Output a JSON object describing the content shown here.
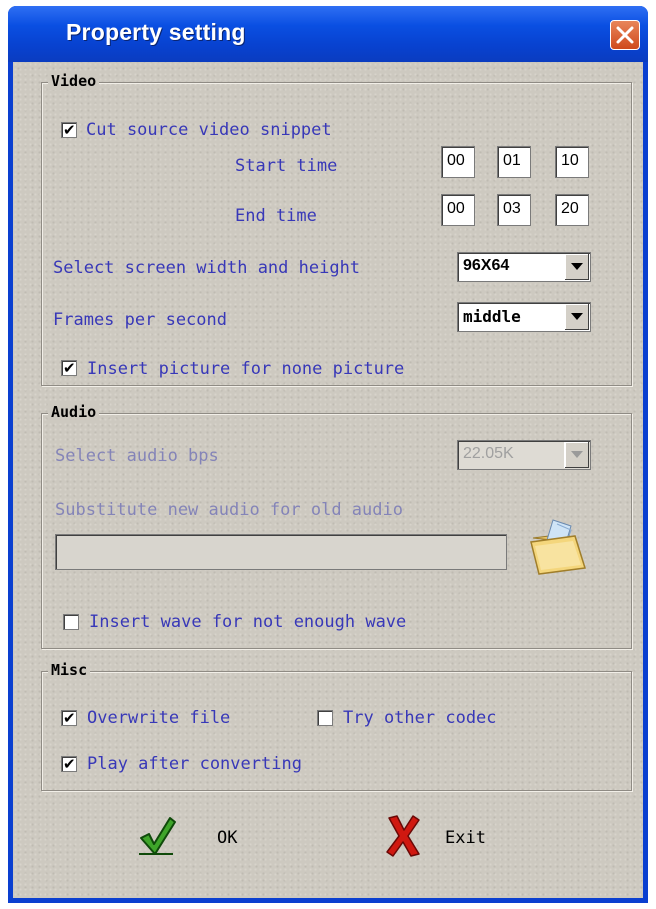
{
  "window": {
    "title": "Property setting"
  },
  "video": {
    "group_label": "Video",
    "cut_snippet": {
      "label": "Cut source video snippet",
      "checked": true
    },
    "start_time": {
      "label": "Start time",
      "hh": "00",
      "mm": "01",
      "ss": "10"
    },
    "end_time": {
      "label": "End time",
      "hh": "00",
      "mm": "03",
      "ss": "20"
    },
    "screen_size": {
      "label": "Select screen width and height",
      "value": "96X64"
    },
    "fps": {
      "label": "Frames per second",
      "value": "middle"
    },
    "insert_picture": {
      "label": "Insert picture for none picture",
      "checked": true
    }
  },
  "audio": {
    "group_label": "Audio",
    "bps": {
      "label": "Select audio bps",
      "value": "22.05K",
      "enabled": false
    },
    "substitute": {
      "label": "Substitute new audio for old audio",
      "path": ""
    },
    "insert_wave": {
      "label": "Insert wave for not enough wave",
      "checked": false
    }
  },
  "misc": {
    "group_label": "Misc",
    "overwrite": {
      "label": "Overwrite file",
      "checked": true
    },
    "try_codec": {
      "label": "Try other codec",
      "checked": false
    },
    "play_after": {
      "label": "Play after converting",
      "checked": true
    }
  },
  "buttons": {
    "ok": "OK",
    "exit": "Exit"
  },
  "colors": {
    "title_bar": "#0a4fe2",
    "label_text": "#3838b8",
    "dialog_bg": "#cdc9c0",
    "close_button": "#d9582a"
  }
}
